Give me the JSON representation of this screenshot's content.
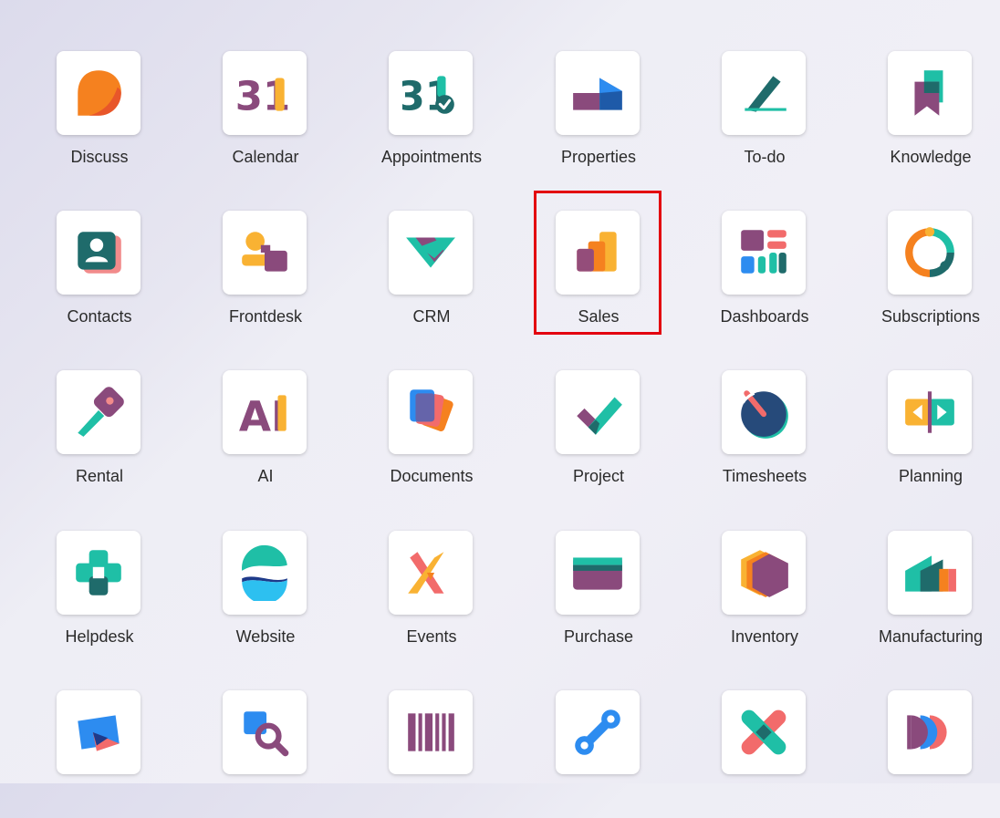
{
  "apps": [
    {
      "label": "Discuss"
    },
    {
      "label": "Calendar"
    },
    {
      "label": "Appointments"
    },
    {
      "label": "Properties"
    },
    {
      "label": "To-do"
    },
    {
      "label": "Knowledge"
    },
    {
      "label": "Contacts"
    },
    {
      "label": "Frontdesk"
    },
    {
      "label": "CRM"
    },
    {
      "label": "Sales"
    },
    {
      "label": "Dashboards"
    },
    {
      "label": "Subscriptions"
    },
    {
      "label": "Rental"
    },
    {
      "label": "AI"
    },
    {
      "label": "Documents"
    },
    {
      "label": "Project"
    },
    {
      "label": "Timesheets"
    },
    {
      "label": "Planning"
    },
    {
      "label": "Helpdesk"
    },
    {
      "label": "Website"
    },
    {
      "label": "Events"
    },
    {
      "label": "Purchase"
    },
    {
      "label": "Inventory"
    },
    {
      "label": "Manufacturing"
    }
  ],
  "icons": {
    "calendar_glyph": "31",
    "appointments_glyph": "31",
    "ai_glyph": "AI"
  },
  "colors": {
    "highlight": "#e3000f",
    "purple": "#8a4a7c",
    "teal": "#1fbfa6",
    "dark_teal": "#1f6b6b",
    "orange": "#f5811f",
    "yellow": "#f9b233",
    "coral": "#f26b6b",
    "blue": "#2d8cf0"
  }
}
